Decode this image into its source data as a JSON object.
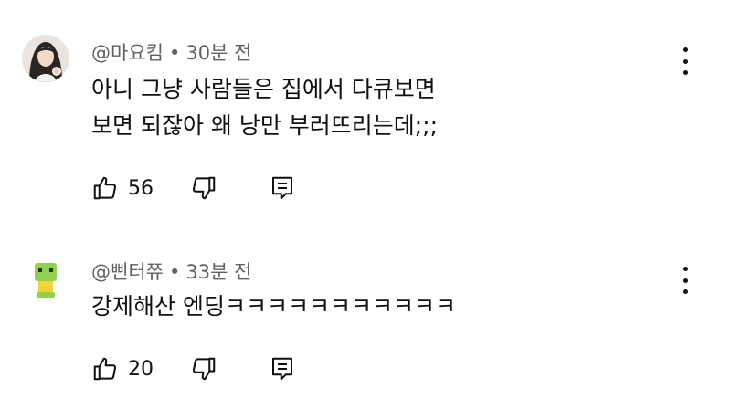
{
  "comments": [
    {
      "author": "@마요킴",
      "time": "30분 전",
      "lines": [
        "아니 그냥 사람들은 집에서 다큐보면",
        "보면 되잖아 왜 낭만 부러뜨리는데;;;"
      ],
      "likes": "56",
      "avatar_icon": "user-photo-avatar"
    },
    {
      "author": "@삔터쮸",
      "time": "33분 전",
      "lines": [
        "강제해산 엔딩ㅋㅋㅋㅋㅋㅋㅋㅋㅋㅋㅋ"
      ],
      "likes": "20",
      "avatar_icon": "green-character-avatar"
    }
  ],
  "separator": "•",
  "colors": {
    "meta": "#606060",
    "text": "#0f0f0f"
  }
}
